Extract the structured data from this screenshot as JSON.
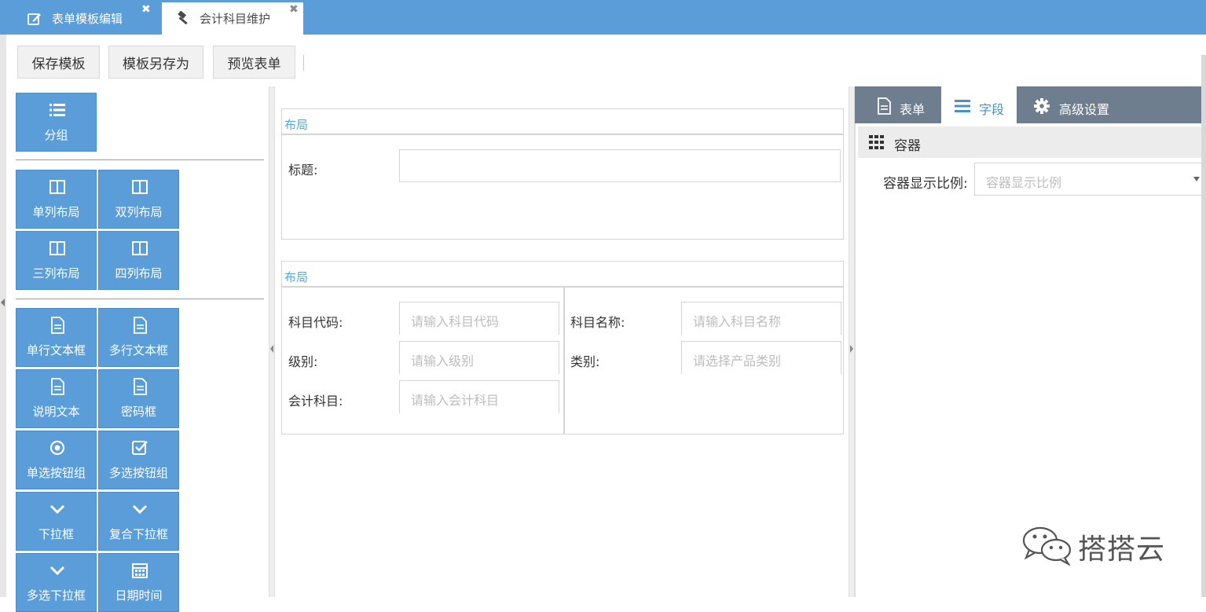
{
  "tabs": [
    {
      "label": "表单模板编辑",
      "icon": "edit-icon",
      "active": false
    },
    {
      "label": "会计科目维护",
      "icon": "gavel-icon",
      "active": true
    }
  ],
  "close_symbol": "✖",
  "toolbar": {
    "save_template": "保存模板",
    "save_as_template": "模板另存为",
    "preview_form": "预览表单"
  },
  "palette": {
    "group": {
      "label": "分组",
      "icon": "list-icon"
    },
    "layouts": [
      {
        "label": "单列布局",
        "icon": "columns-icon"
      },
      {
        "label": "双列布局",
        "icon": "columns-icon"
      },
      {
        "label": "三列布局",
        "icon": "columns-icon"
      },
      {
        "label": "四列布局",
        "icon": "columns-icon"
      }
    ],
    "fields": [
      {
        "label": "单行文本框",
        "icon": "file-text-icon"
      },
      {
        "label": "多行文本框",
        "icon": "file-text-icon"
      },
      {
        "label": "说明文本",
        "icon": "file-text-icon"
      },
      {
        "label": "密码框",
        "icon": "file-text-icon"
      },
      {
        "label": "单选按钮组",
        "icon": "radio-icon"
      },
      {
        "label": "多选按钮组",
        "icon": "checkbox-icon"
      },
      {
        "label": "下拉框",
        "icon": "chevron-down-icon"
      },
      {
        "label": "复合下拉框",
        "icon": "chevron-down-icon"
      },
      {
        "label": "多选下拉框",
        "icon": "chevron-down-icon"
      },
      {
        "label": "日期时间",
        "icon": "calendar-icon"
      }
    ]
  },
  "canvas": {
    "section1": {
      "title": "布局",
      "title_field_label": "标题:",
      "title_field_value": ""
    },
    "section2": {
      "title": "布局",
      "left": [
        {
          "label": "科目代码:",
          "placeholder": "请输入科目代码"
        },
        {
          "label": "级别:",
          "placeholder": "请输入级别"
        },
        {
          "label": "会计科目:",
          "placeholder": "请输入会计科目"
        }
      ],
      "right": [
        {
          "label": "科目名称:",
          "placeholder": "请输入科目名称"
        },
        {
          "label": "类别:",
          "placeholder": "请选择产品类别"
        }
      ]
    }
  },
  "right_panel": {
    "tabs": [
      {
        "label": "表单",
        "icon": "file-text-icon",
        "active": false
      },
      {
        "label": "字段",
        "icon": "bars-icon",
        "active": true
      },
      {
        "label": "高级设置",
        "icon": "gear-icon",
        "active": false
      }
    ],
    "section_title": "容器",
    "container_ratio_label": "容器显示比例:",
    "container_ratio_placeholder": "容器显示比例"
  },
  "watermark": "搭搭云",
  "colors": {
    "primary": "#5b9dd9",
    "tab_dark": "#6f7e8f",
    "section_title": "#5aa8d8",
    "placeholder": "#bdbdbd"
  }
}
